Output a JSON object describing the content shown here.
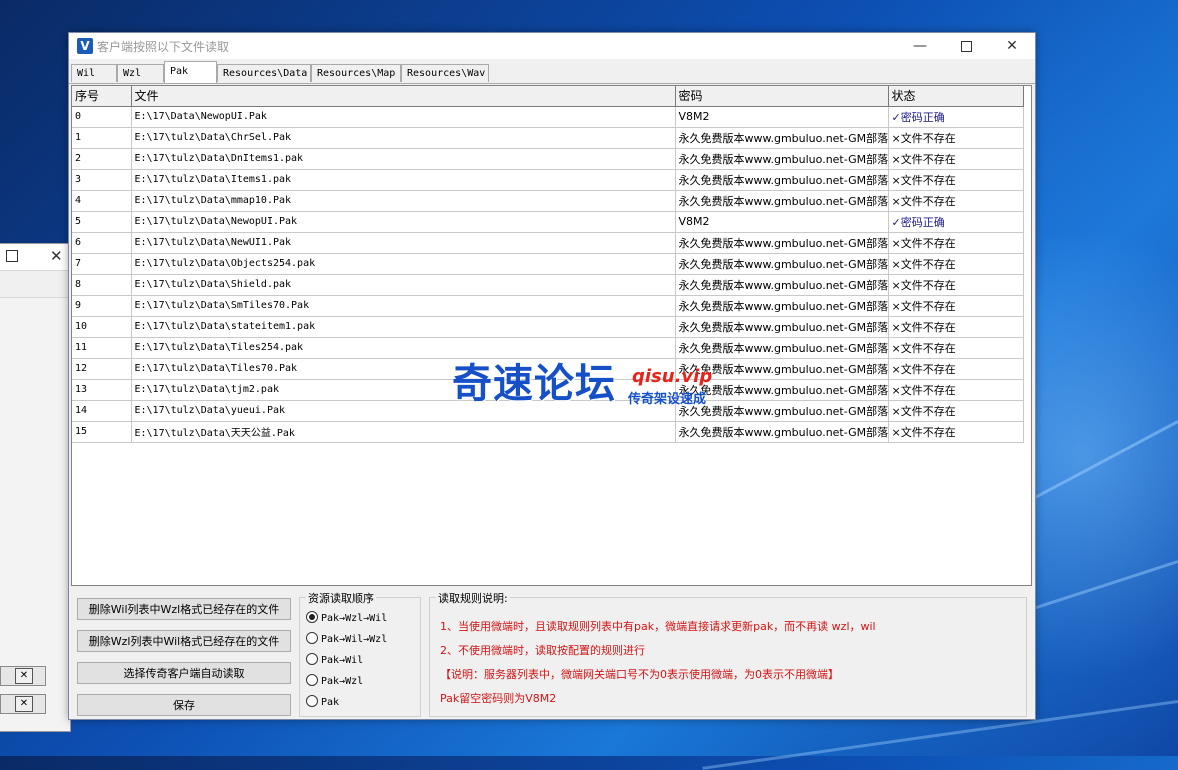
{
  "window": {
    "title": "客户端按照以下文件读取",
    "app_icon": "V"
  },
  "tabs": [
    {
      "label": "Wil"
    },
    {
      "label": "Wzl"
    },
    {
      "label": "Pak"
    },
    {
      "label": "Resources\\Data"
    },
    {
      "label": "Resources\\Map"
    },
    {
      "label": "Resources\\Wav"
    }
  ],
  "active_tab": "Pak",
  "table": {
    "columns": [
      "序号",
      "文件",
      "密码",
      "状态"
    ],
    "rows": [
      {
        "idx": "0",
        "file": "E:\\17\\Data\\NewopUI.Pak",
        "pw": "V8M2",
        "status": "✓密码正确"
      },
      {
        "idx": "1",
        "file": "E:\\17\\tulz\\Data\\ChrSel.Pak",
        "pw": "永久免费版本www.gmbuluo.net-GM部落-",
        "status": "×文件不存在"
      },
      {
        "idx": "2",
        "file": "E:\\17\\tulz\\Data\\DnItems1.pak",
        "pw": "永久免费版本www.gmbuluo.net-GM部落-",
        "status": "×文件不存在"
      },
      {
        "idx": "3",
        "file": "E:\\17\\tulz\\Data\\Items1.pak",
        "pw": "永久免费版本www.gmbuluo.net-GM部落-",
        "status": "×文件不存在"
      },
      {
        "idx": "4",
        "file": "E:\\17\\tulz\\Data\\mmap10.Pak",
        "pw": "永久免费版本www.gmbuluo.net-GM部落-",
        "status": "×文件不存在"
      },
      {
        "idx": "5",
        "file": "E:\\17\\tulz\\Data\\NewopUI.Pak",
        "pw": "V8M2",
        "status": "✓密码正确"
      },
      {
        "idx": "6",
        "file": "E:\\17\\tulz\\Data\\NewUI1.Pak",
        "pw": "永久免费版本www.gmbuluo.net-GM部落-",
        "status": "×文件不存在"
      },
      {
        "idx": "7",
        "file": "E:\\17\\tulz\\Data\\Objects254.pak",
        "pw": "永久免费版本www.gmbuluo.net-GM部落-",
        "status": "×文件不存在"
      },
      {
        "idx": "8",
        "file": "E:\\17\\tulz\\Data\\Shield.pak",
        "pw": "永久免费版本www.gmbuluo.net-GM部落-",
        "status": "×文件不存在"
      },
      {
        "idx": "9",
        "file": "E:\\17\\tulz\\Data\\SmTiles70.Pak",
        "pw": "永久免费版本www.gmbuluo.net-GM部落-",
        "status": "×文件不存在"
      },
      {
        "idx": "10",
        "file": "E:\\17\\tulz\\Data\\stateitem1.pak",
        "pw": "永久免费版本www.gmbuluo.net-GM部落-",
        "status": "×文件不存在"
      },
      {
        "idx": "11",
        "file": "E:\\17\\tulz\\Data\\Tiles254.pak",
        "pw": "永久免费版本www.gmbuluo.net-GM部落-",
        "status": "×文件不存在"
      },
      {
        "idx": "12",
        "file": "E:\\17\\tulz\\Data\\Tiles70.Pak",
        "pw": "永久免费版本www.gmbuluo.net-GM部落-",
        "status": "×文件不存在"
      },
      {
        "idx": "13",
        "file": "E:\\17\\tulz\\Data\\tjm2.pak",
        "pw": "永久免费版本www.gmbuluo.net-GM部落-",
        "status": "×文件不存在"
      },
      {
        "idx": "14",
        "file": "E:\\17\\tulz\\Data\\yueui.Pak",
        "pw": "永久免费版本www.gmbuluo.net-GM部落-",
        "status": "×文件不存在"
      },
      {
        "idx": "15",
        "file": "E:\\17\\tulz\\Data\\天天公益.Pak",
        "pw": "永久免费版本www.gmbuluo.net-GM部落-",
        "status": "×文件不存在"
      }
    ]
  },
  "buttons": {
    "del_wil": "删除Wil列表中Wzl格式已经存在的文件",
    "del_wzl": "删除Wzl列表中Wil格式已经存在的文件",
    "select_client": "选择传奇客户端自动读取",
    "save": "保存"
  },
  "order_group": {
    "label": "资源读取顺序",
    "options": [
      "Pak→Wzl→Wil",
      "Pak→Wil→Wzl",
      "Pak→Wil",
      "Pak→Wzl",
      "Pak"
    ],
    "selected": 0
  },
  "rules_group": {
    "label": "读取规则说明:",
    "lines": [
      "1、当使用微端时，且读取规则列表中有pak，微端直接请求更新pak，而不再读 wzl，wil",
      "2、不使用微端时，读取按配置的规则进行",
      "【说明：服务器列表中，微端网关端口号不为0表示使用微端，为0表示不用微端】",
      "Pak留空密码则为V8M2"
    ]
  },
  "watermark": {
    "main": "奇速论坛",
    "url": "qisu.vip",
    "sub": "传奇架设速成"
  },
  "colors": {
    "rule_text": "#d41414",
    "ok_status": "#1a1a8c",
    "watermark_blue": "#1550c8",
    "watermark_red": "#e8241a"
  }
}
